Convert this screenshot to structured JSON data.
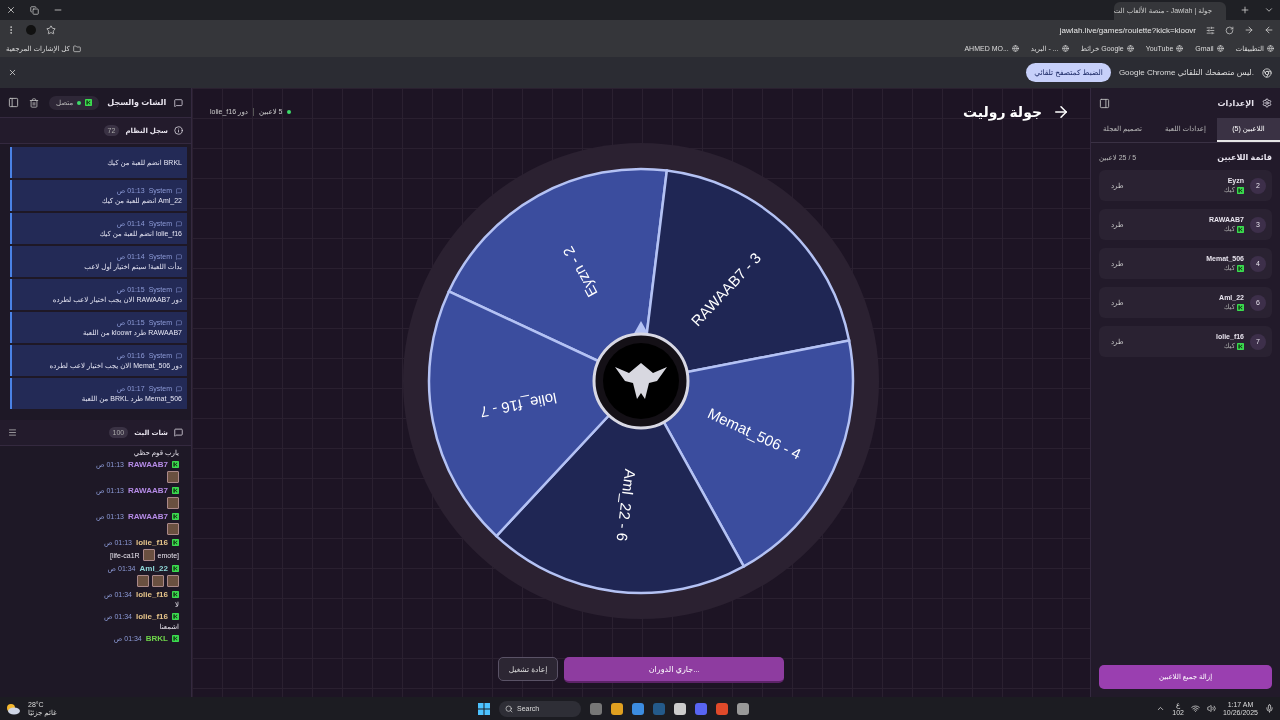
{
  "browser": {
    "tab_title": "جولة | Jawlah - منصة الألعاب الت",
    "url": "jawlah.live/games/roulette?kick=kloovr",
    "all_bookmarks": "كل الإشارات المرجعية",
    "bookmarks": [
      "التطبيقات",
      "Gmail",
      "YouTube",
      "خرائط Google",
      "البريد - ...",
      "AHMED MO..."
    ],
    "infobar": {
      "message": "Google Chrome ليس متصفحك التلقائي.",
      "button": "الضبط كمتصفح تلقائي"
    }
  },
  "left_panel": {
    "title": "الشات والسجل",
    "status": "متصل",
    "log": {
      "title": "سجل النظام",
      "count": "72",
      "entries": [
        {
          "text": "BRKL انضم للعبة من كيك"
        },
        {
          "sender": "System",
          "time": "01:13 ص",
          "text": "Aml_22 انضم للعبة من كيك"
        },
        {
          "sender": "System",
          "time": "01:14 ص",
          "text": "lolie_f16 انضم للعبة من كيك"
        },
        {
          "sender": "System",
          "time": "01:14 ص",
          "text": "بدأت اللعبة! سيتم اختيار أول لاعب"
        },
        {
          "sender": "System",
          "time": "01:15 ص",
          "text": "دور RAWAAB7 الان يجب اختيار لاعب لطرده"
        },
        {
          "sender": "System",
          "time": "01:15 ص",
          "text": "RAWAAB7 طرد kloowr من اللعبة"
        },
        {
          "sender": "System",
          "time": "01:16 ص",
          "text": "دور Memat_506 الان يجب اختيار لاعب لطرده"
        },
        {
          "sender": "System",
          "time": "01:17 ص",
          "text": "Memat_506 طرد BRKL من اللعبة"
        }
      ]
    },
    "chat": {
      "title": "شات البث",
      "count": "100",
      "messages": [
        {
          "content": [
            {
              "kind": "text",
              "text": "يارب قوم حظي"
            }
          ]
        },
        {
          "user": "RAWAAB7",
          "color": "#b58be6",
          "time": "01:13 ص",
          "content": [
            {
              "kind": "emote"
            }
          ]
        },
        {
          "user": "RAWAAB7",
          "color": "#b58be6",
          "time": "01:13 ص",
          "content": [
            {
              "kind": "emote"
            }
          ]
        },
        {
          "user": "RAWAAB7",
          "color": "#b58be6",
          "time": "01:13 ص",
          "content": [
            {
              "kind": "emote"
            }
          ]
        },
        {
          "user": "lolie_f16",
          "color": "#e6c48a",
          "time": "01:13 ص",
          "content": [
            {
              "kind": "text",
              "text": "[emote"
            },
            {
              "kind": "emote"
            },
            {
              "kind": "text",
              "text": "life-ca1R]"
            }
          ]
        },
        {
          "user": "Aml_22",
          "color": "#8fd8d8",
          "time": "01:34 ص",
          "content": [
            {
              "kind": "emote"
            },
            {
              "kind": "emote"
            },
            {
              "kind": "emote"
            }
          ]
        },
        {
          "user": "lolie_f16",
          "color": "#e6c48a",
          "time": "01:34 ص",
          "content": [
            {
              "kind": "text",
              "text": "لا"
            }
          ]
        },
        {
          "user": "lolie_f16",
          "color": "#e6c48a",
          "time": "01:34 ص",
          "content": [
            {
              "kind": "text",
              "text": "اشمعنا"
            }
          ]
        },
        {
          "user": "BRKL",
          "color": "#6fd64a",
          "time": "01:34 ص"
        }
      ]
    }
  },
  "stage": {
    "turn": "دور lolie_f16",
    "players_count": "5 لاعبين",
    "title": "جولة روليت",
    "wheel": [
      {
        "label": "Eyzn - 2",
        "color": "#3b4d9e"
      },
      {
        "label": "RAWAAB7 - 3",
        "color": "#1f2654"
      },
      {
        "label": "Memat_506 - 4",
        "color": "#3b4d9e"
      },
      {
        "label": "Aml_22 - 6",
        "color": "#1f2654"
      },
      {
        "label": "lolie_f16 - 7",
        "color": "#3b4d9e"
      }
    ],
    "restart": "إعادة تشغيل",
    "spin": "جاري الدوران..."
  },
  "settings": {
    "title": "الإعدادات",
    "tabs": [
      {
        "label": "اللاعبين (5)",
        "selected": true
      },
      {
        "label": "إعدادات اللعبة",
        "selected": false
      },
      {
        "label": "تصميم العجلة",
        "selected": false
      }
    ],
    "list_title": "قائمة اللاعبين",
    "capacity": "5 / 25 لاعبين",
    "players": [
      {
        "number": "2",
        "name": "Eyzn",
        "platform": "كيك",
        "action": "طرد"
      },
      {
        "number": "3",
        "name": "RAWAAB7",
        "platform": "كيك",
        "action": "طرد"
      },
      {
        "number": "4",
        "name": "Memat_506",
        "platform": "كيك",
        "action": "طرد"
      },
      {
        "number": "6",
        "name": "Aml_22",
        "platform": "كيك",
        "action": "طرد"
      },
      {
        "number": "7",
        "name": "lolie_f16",
        "platform": "كيك",
        "action": "طرد"
      }
    ],
    "remove_all": "إزالة جميع اللاعبين"
  },
  "taskbar": {
    "temperature": "28°C",
    "weather": "غائم جزئيًا",
    "search": "Search",
    "language": "ع",
    "language_sub": "102",
    "time": "1:17 AM",
    "date": "10/26/2025"
  }
}
